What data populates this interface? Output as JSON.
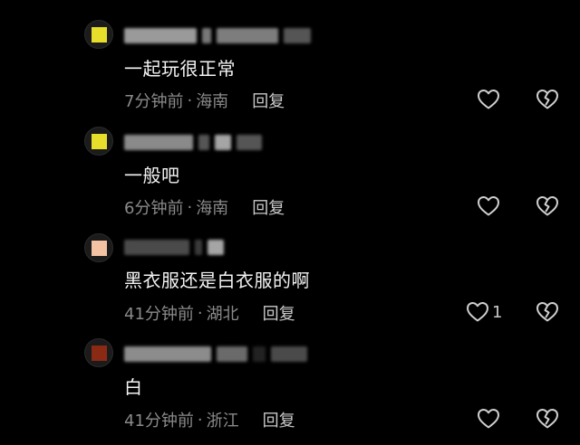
{
  "comments": [
    {
      "avatar_color": "#e7de2c",
      "text": "一起玩很正常",
      "time": "7分钟前",
      "separator": "·",
      "location": "海南",
      "reply_label": "回复",
      "like_count": ""
    },
    {
      "avatar_color": "#e7de2c",
      "text": "一般吧",
      "time": "6分钟前",
      "separator": "·",
      "location": "海南",
      "reply_label": "回复",
      "like_count": ""
    },
    {
      "avatar_color": "#f3c3a3",
      "text": "黑衣服还是白衣服的啊",
      "time": "41分钟前",
      "separator": "·",
      "location": "湖北",
      "reply_label": "回复",
      "like_count": "1"
    },
    {
      "avatar_color": "#8a2a15",
      "text": "白",
      "time": "41分钟前",
      "separator": "·",
      "location": "浙江",
      "reply_label": "回复",
      "like_count": ""
    }
  ],
  "icons": {
    "like": "heart-outline-icon",
    "dislike": "broken-heart-icon"
  }
}
